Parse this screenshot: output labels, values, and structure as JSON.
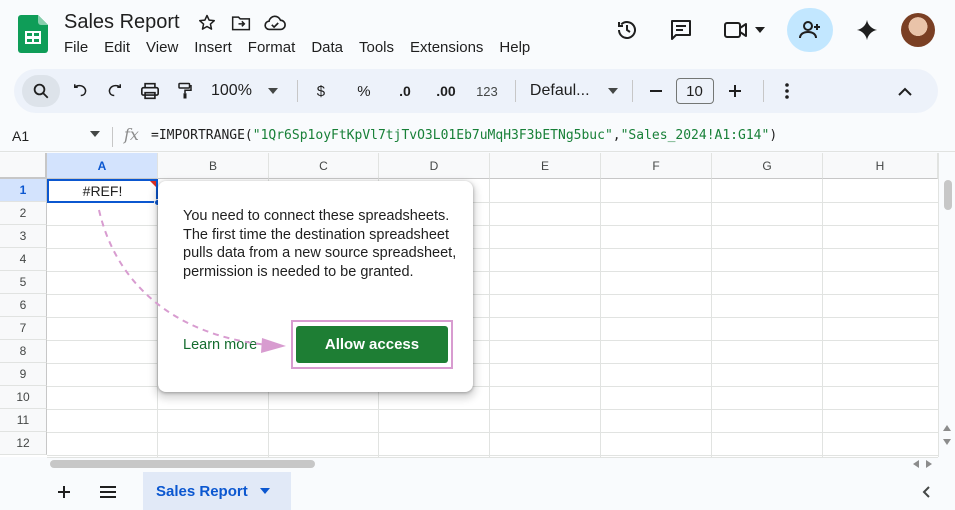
{
  "header": {
    "doc_title": "Sales Report",
    "menu": [
      "File",
      "Edit",
      "View",
      "Insert",
      "Format",
      "Data",
      "Tools",
      "Extensions",
      "Help"
    ]
  },
  "toolbar": {
    "zoom": "100%",
    "currency": "$",
    "percent": "%",
    "decrease_decimal": ".0",
    "increase_decimal": ".00",
    "number_format": "123",
    "font": "Defaul...",
    "font_size": "10"
  },
  "formula_bar": {
    "cell_ref": "A1",
    "fx": "fx",
    "formula_prefix": "=IMPORTRANGE(",
    "formula_arg1": "\"1Qr6Sp1oyFtKpVl7tjTvO3L01Eb7uMqH3F3bETNg5buc\"",
    "formula_comma": ",",
    "formula_arg2": "\"Sales_2024!A1:G14\"",
    "formula_suffix": ")"
  },
  "grid": {
    "columns": [
      "A",
      "B",
      "C",
      "D",
      "E",
      "F",
      "G",
      "H"
    ],
    "rows": [
      "1",
      "2",
      "3",
      "4",
      "5",
      "6",
      "7",
      "8",
      "9",
      "10",
      "11",
      "12"
    ],
    "a1_value": "#REF!"
  },
  "popup": {
    "message": "You need to connect these spreadsheets. The first time the destination spreadsheet pulls data from a new source spreadsheet, permission is needed to be granted.",
    "learn_more": "Learn more",
    "allow_button": "Allow access"
  },
  "sheets": {
    "active_tab": "Sales Report"
  },
  "colors": {
    "accent_blue": "#0b57d0",
    "allow_green": "#1e7e34",
    "annotation_pink": "#d89cd0"
  }
}
